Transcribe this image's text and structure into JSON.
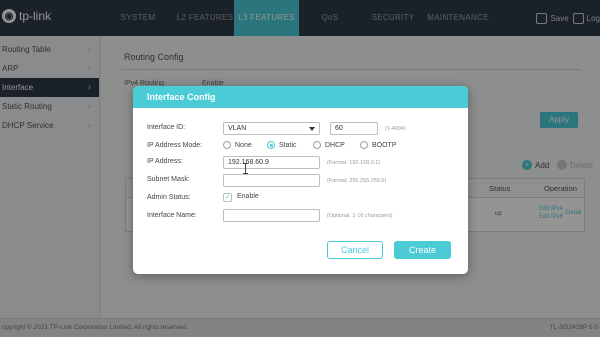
{
  "header": {
    "logo_text": "tp-link",
    "nav": [
      {
        "label": "SYSTEM",
        "active": false
      },
      {
        "label": "L2 FEATURES",
        "active": false
      },
      {
        "label": "L3 FEATURES",
        "active": true
      },
      {
        "label": "QoS",
        "active": false
      },
      {
        "label": "SECURITY",
        "active": false
      },
      {
        "label": "MAINTENANCE",
        "active": false
      }
    ],
    "save_label": "Save",
    "logout_label": "Log"
  },
  "sidebar": {
    "items": [
      {
        "label": "Routing Table",
        "active": false
      },
      {
        "label": "ARP",
        "active": false
      },
      {
        "label": "Interface",
        "active": true
      },
      {
        "label": "Static Routing",
        "active": false
      },
      {
        "label": "DHCP Service",
        "active": false
      }
    ]
  },
  "main": {
    "section_title": "Routing Config",
    "ipv4_routing_label": "IPv4 Routing",
    "ipv4_routing_value": "Enable",
    "apply_label": "Apply",
    "add_label": "Add",
    "delete_label": "Delete",
    "table": {
      "headers": {
        "status": "Status",
        "operation": "Operation"
      },
      "row": {
        "status": "up",
        "op_edit_ipv4": "Edit IPv4",
        "op_edit_ipv6": "Edit IPv6",
        "op_detail": "Detail"
      }
    }
  },
  "modal": {
    "title": "Interface Config",
    "interface_id_label": "Interface ID:",
    "interface_id_type": "VLAN",
    "interface_id_value": "60",
    "interface_id_hint": "(1-4094)",
    "ip_mode_label": "IP Address Mode:",
    "ip_mode_options": [
      "None",
      "Static",
      "DHCP",
      "BOOTP"
    ],
    "ip_mode_selected": "Static",
    "ip_address_label": "IP Address:",
    "ip_address_value": "192.168.60.9",
    "ip_address_hint": "(Format: 192.168.0.1)",
    "subnet_mask_label": "Subnet Mask:",
    "subnet_mask_value": "",
    "subnet_mask_hint": "(Format: 255.255.255.0)",
    "admin_status_label": "Admin Status:",
    "admin_status_option": "Enable",
    "admin_status_checked": true,
    "interface_name_label": "Interface Name:",
    "interface_name_value": "",
    "interface_name_hint": "(Optional. 1-16 characters)",
    "cancel_label": "Cancel",
    "create_label": "Create"
  },
  "footer": {
    "copyright": "opyright © 2021    TP-Link Corporation Limited. All rights reserved.",
    "model": "TL-SG2428P 5.0"
  },
  "colors": {
    "accent": "#4acbd6",
    "topbar": "#2f3a45"
  }
}
